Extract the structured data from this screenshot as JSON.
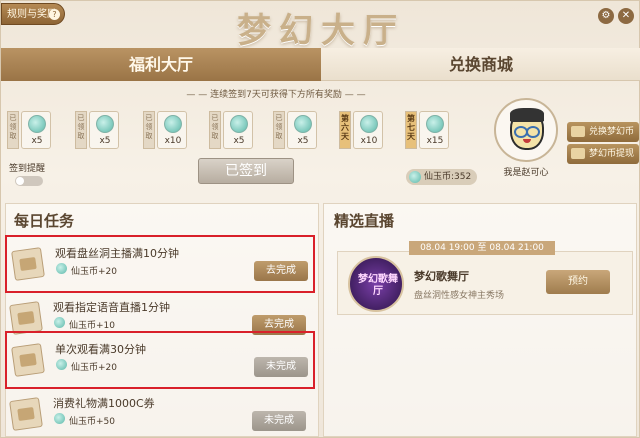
{
  "header": {
    "rules_label": "规则与奖励",
    "title": "梦幻大厅",
    "settings_glyph": "⚙",
    "close_glyph": "✕"
  },
  "tabs": [
    {
      "label": "福利大厅",
      "active": true
    },
    {
      "label": "兑换商城",
      "active": false
    }
  ],
  "signin": {
    "hint": "— — 连续签到7天可获得下方所有奖励 — —",
    "days": [
      {
        "tag": "已领取",
        "count": "x5",
        "special": false
      },
      {
        "tag": "已领取",
        "count": "x5",
        "special": false
      },
      {
        "tag": "已领取",
        "count": "x10",
        "special": false
      },
      {
        "tag": "已领取",
        "count": "x5",
        "special": false
      },
      {
        "tag": "已领取",
        "count": "x5",
        "special": false
      },
      {
        "tag": "第六天",
        "count": "x10",
        "special": true
      },
      {
        "tag": "第七天",
        "count": "x15",
        "special": true
      }
    ],
    "signed_label": "已签到",
    "remind_label": "签到提醒",
    "balance": "仙玉币:352"
  },
  "profile": {
    "name": "我是赵可心",
    "exchange_label": "兑换梦幻币",
    "withdraw_label": "梦幻币提现"
  },
  "daily": {
    "title": "每日任务",
    "tasks": [
      {
        "name": "观看盘丝洞主播满10分钟",
        "reward": "仙玉币+20",
        "button": "去完成",
        "state": "go",
        "highlight": true
      },
      {
        "name": "观看指定语音直播1分钟",
        "reward": "仙玉币+10",
        "button": "去完成",
        "state": "go",
        "highlight": false
      },
      {
        "name": "单次观看满30分钟",
        "reward": "仙玉币+20",
        "button": "未完成",
        "state": "undone",
        "highlight": true
      },
      {
        "name": "消费礼物满1000C券",
        "reward": "仙玉币+50",
        "button": "未完成",
        "state": "undone",
        "highlight": false
      }
    ]
  },
  "live": {
    "title": "精选直播",
    "time": "08.04 19:00 至 08.04 21:00",
    "thumb_text": "梦幻歌舞厅",
    "name": "梦幻歌舞厅",
    "subtitle": "盘丝洞性感女神主秀场",
    "button": "预约"
  }
}
